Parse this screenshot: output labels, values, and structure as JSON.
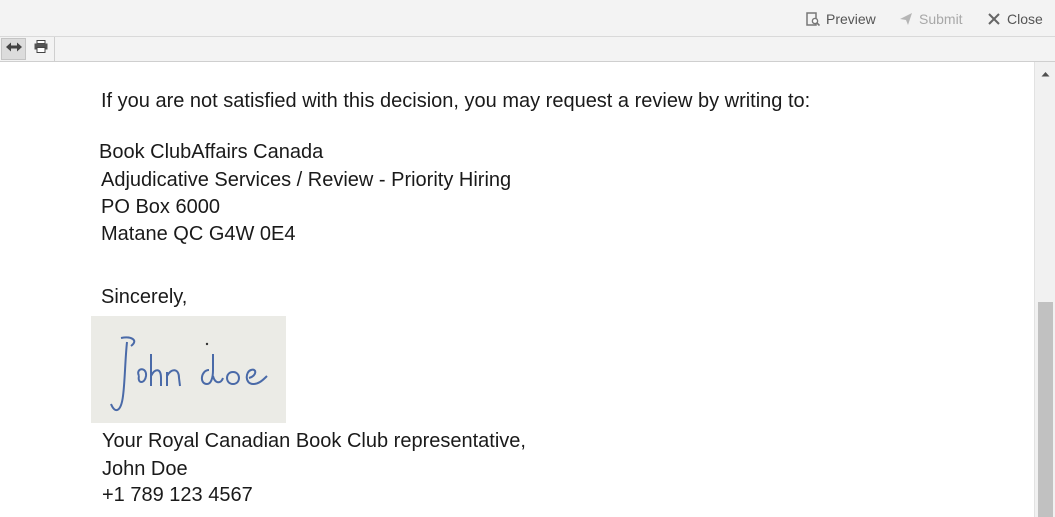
{
  "header": {
    "preview_label": "Preview",
    "submit_label": "Submit",
    "close_label": "Close"
  },
  "toolbar": {
    "toggle_icon": "swap-arrows-icon",
    "print_icon": "printer-icon"
  },
  "letter": {
    "review_text": "If you are not satisfied with this decision, you may request a review by writing to:",
    "address": [
      "Book ClubAffairs Canada",
      "Adjudicative Services / Review - Priority Hiring",
      "PO Box 6000",
      "Matane QC  G4W 0E4"
    ],
    "closing": "Sincerely,",
    "signature_text": "John doe",
    "signoff": [
      "Your Royal Canadian Book Club representative,",
      "John Doe",
      "+1 789 123 4567"
    ]
  },
  "colors": {
    "signature_ink": "#4a6aa8",
    "disabled_text": "#a8a8a8"
  }
}
